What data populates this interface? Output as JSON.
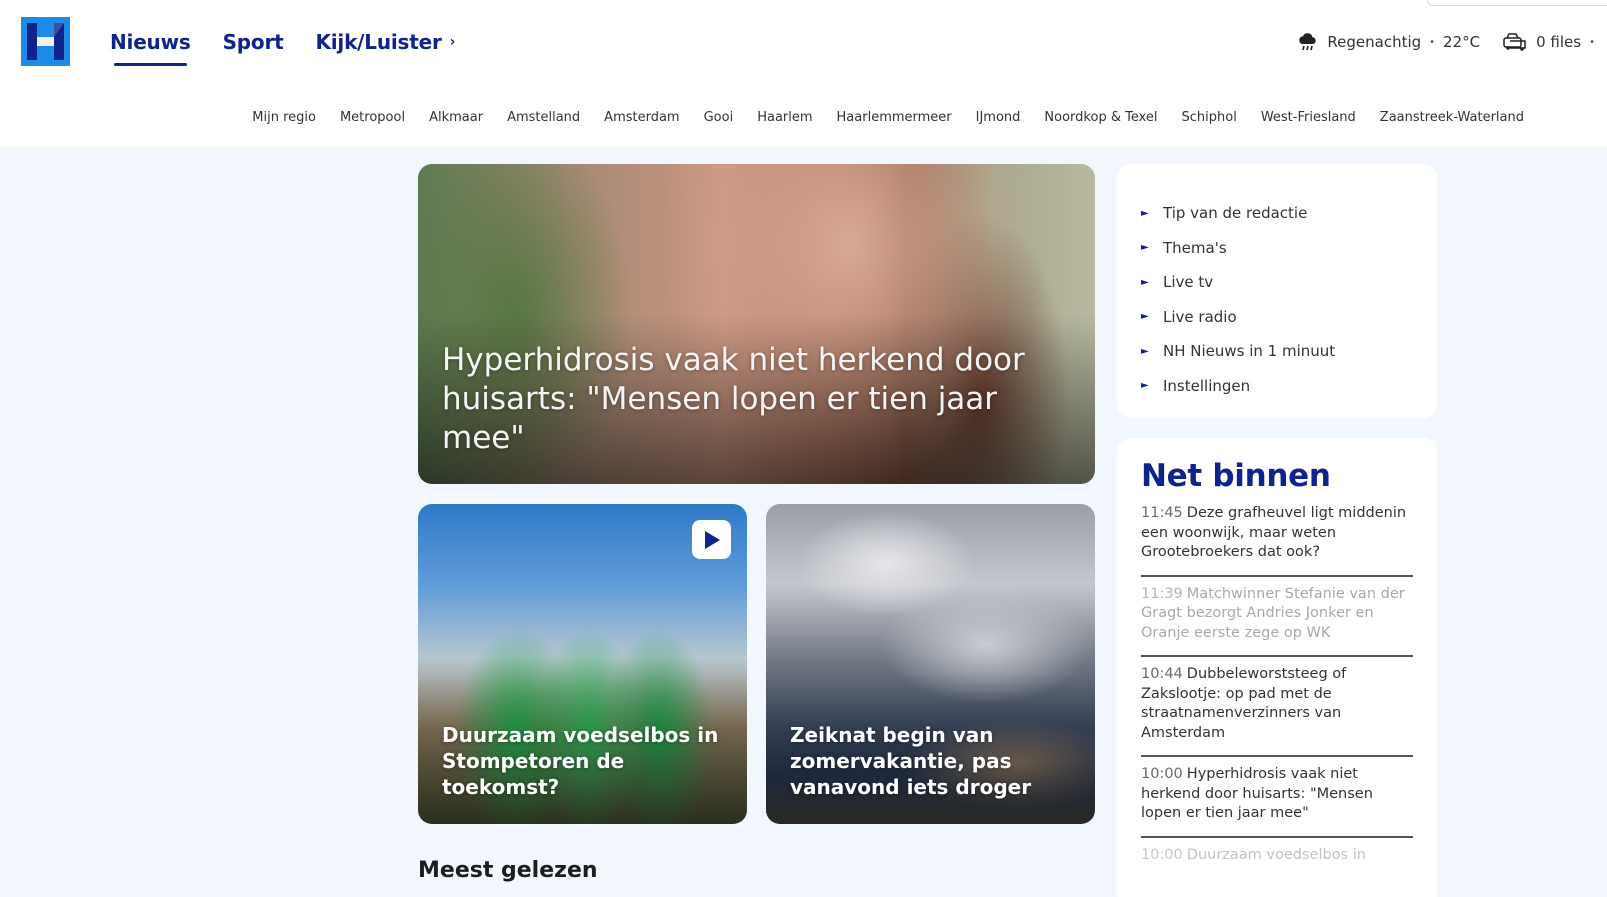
{
  "header": {
    "nav": [
      {
        "label": "Nieuws",
        "active": true
      },
      {
        "label": "Sport",
        "active": false
      },
      {
        "label": "Kijk/Luister",
        "active": false
      }
    ],
    "kijk_chevron": "›",
    "weather": {
      "label": "Regenachtig",
      "separator": "•",
      "temp": "22°C",
      "icon": "rain-cloud-icon"
    },
    "traffic": {
      "label": "0 files",
      "separator": "•",
      "icon": "car-icon"
    },
    "regions": [
      "Mijn regio",
      "Metropool",
      "Alkmaar",
      "Amstelland",
      "Amsterdam",
      "Gooi",
      "Haarlem",
      "Haarlemmermeer",
      "IJmond",
      "Noordkop & Texel",
      "Schiphol",
      "West-Friesland",
      "Zaanstreek-Waterland"
    ],
    "brand_color": "#0f238c"
  },
  "hero": {
    "title": "Hyperhidrosis vaak niet herkend door huisarts: \"Mensen lopen er tien jaar mee\""
  },
  "cards": [
    {
      "title": "Duurzaam voedselbos in Stompetoren de toekomst?",
      "has_video": true
    },
    {
      "title": "Zeiknat begin van zomervakantie, pas vanavond iets droger",
      "has_video": false
    }
  ],
  "most_read": {
    "title": "Meest gelezen"
  },
  "menu": {
    "items": [
      "Tip van de redactie",
      "Thema's",
      "Live tv",
      "Live radio",
      "NH Nieuws in 1 minuut",
      "Instellingen"
    ]
  },
  "net_binnen": {
    "title": "Net binnen",
    "items": [
      {
        "time": "11:45",
        "text": "Deze grafheuvel ligt middenin een woonwijk, maar weten Grootebroekers dat ook?"
      },
      {
        "time": "11:39",
        "text": "Matchwinner Stefanie van der Gragt bezorgt Andries Jonker en Oranje eerste zege op WK"
      },
      {
        "time": "10:44",
        "text": "Dubbeleworststeeg of Zakslootje: op pad met de straatnamenverzinners van Amsterdam"
      },
      {
        "time": "10:00",
        "text": "Hyperhidrosis vaak niet herkend door huisarts: \"Mensen lopen er tien jaar mee\""
      },
      {
        "time": "10:00",
        "text": "Duurzaam voedselbos in"
      }
    ]
  }
}
